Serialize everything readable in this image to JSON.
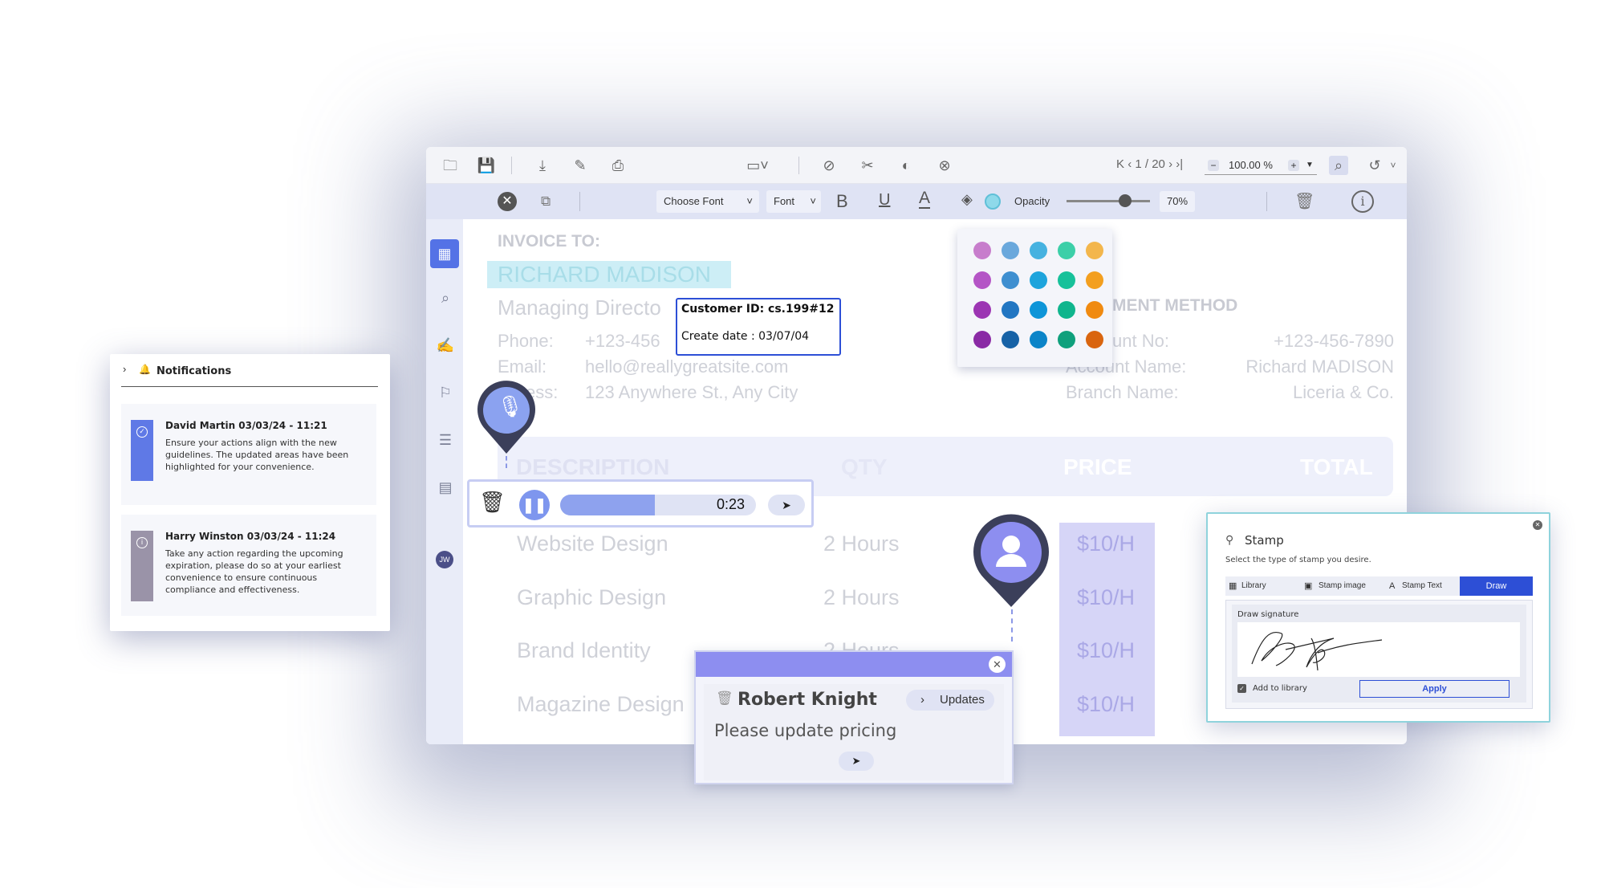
{
  "toolbar": {
    "page_current": "1",
    "page_total": "20",
    "zoom": "100.00 %"
  },
  "format_bar": {
    "font_family": "Choose Font",
    "font_size": "Font",
    "bold": "B",
    "underline": "U",
    "text_color": "A",
    "opacity_label": "Opacity",
    "opacity_value": "70%"
  },
  "palette": {
    "colors": [
      [
        "#c77dcc",
        "#6aa8dc",
        "#46b2e0",
        "#3ccfa8",
        "#f3b64c"
      ],
      [
        "#b455c6",
        "#3f8fd0",
        "#1ea4dc",
        "#17c19a",
        "#f39f1f"
      ],
      [
        "#9c35b3",
        "#2276c2",
        "#0e95d8",
        "#0fb58d",
        "#f08a10"
      ],
      [
        "#8a2aa5",
        "#1762a6",
        "#0b84c8",
        "#0fa07c",
        "#d9650f"
      ]
    ]
  },
  "invoice": {
    "heading": "INVOICE TO:",
    "name": "RICHARD MADISON",
    "title": "Managing Directo",
    "phone_label": "Phone:",
    "phone_value": "+123-456",
    "email_label": "Email:",
    "email_value": "hello@reallygreatsite.com",
    "address_label": "ess:",
    "address_value": "123 Anywhere St., Any City",
    "payment_heading": "MENT METHOD",
    "account_no_label": "unt No:",
    "account_no_value": "+123-456-7890",
    "account_name_label": "Account Name:",
    "account_name_value": "Richard MADISON",
    "branch_label": "Branch Name:",
    "branch_value": "Liceria & Co.",
    "table_headers": [
      "DESCRIPTION",
      "QTY",
      "PRICE",
      "TOTAL"
    ],
    "rows": [
      {
        "desc": "Website Design",
        "qty": "2 Hours",
        "price": "$10/H"
      },
      {
        "desc": "Graphic Design",
        "qty": "2 Hours",
        "price": "$10/H"
      },
      {
        "desc": "Brand Identity",
        "qty": "2 Hours",
        "price": "$10/H"
      },
      {
        "desc": "Magazine Design",
        "qty": "",
        "price": "$10/H"
      }
    ]
  },
  "tooltip": {
    "customer_id": "Customer ID: cs.199#12",
    "create_date": "Create date : 03/07/04"
  },
  "audio": {
    "time": "0:23",
    "progress": 0.72
  },
  "avatar_initials": "JW",
  "notifications": {
    "title": "Notifications",
    "items": [
      {
        "header": "David Martin 03/03/24 - 11:21",
        "body": "Ensure your actions align with the new guidelines. The updated areas have been highlighted for your convenience.",
        "bar_color": "#5f79e6"
      },
      {
        "header": "Harry Winston 03/03/24 - 11:24",
        "body": "Take any action regarding the upcoming expiration, please do so at your earliest convenience to ensure continuous compliance and effectiveness.",
        "bar_color": "#9a93a8"
      }
    ]
  },
  "comment": {
    "author": "Robert Knight",
    "tag": "Updates",
    "text": "Please update pricing"
  },
  "stamp": {
    "title": "Stamp",
    "subtitle": "Select the type of stamp you desire.",
    "tabs": [
      "Library",
      "Stamp image",
      "Stamp Text",
      "Draw"
    ],
    "draw_label": "Draw signature",
    "add_to_library": "Add to library",
    "apply": "Apply"
  },
  "colors": {
    "accent": "#2d4fd6",
    "primary_purple": "#8d8ef0",
    "highlight": "#cdeef6"
  }
}
